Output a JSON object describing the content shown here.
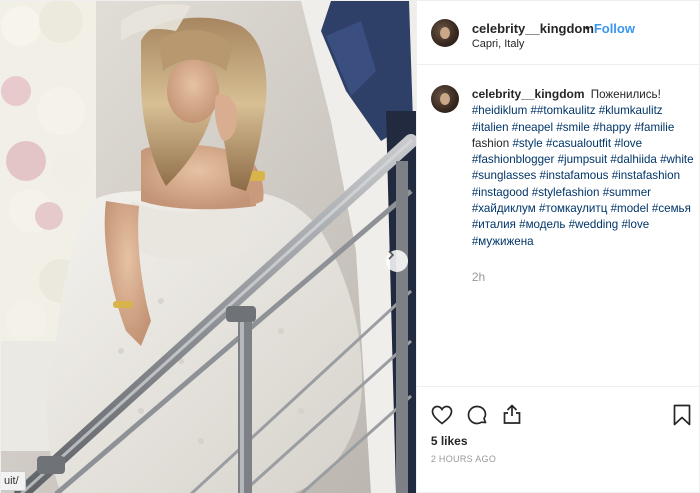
{
  "post": {
    "username": "celebrity__kingdom",
    "separator": "•",
    "follow_label": "Follow",
    "location": "Capri, Italy",
    "caption_text": "Поженились!",
    "hashtags": [
      "#heidiklum",
      "##tomkaulitz",
      "#klumkaulitz",
      "#italien",
      "#neapel",
      "#smile",
      "#happy",
      "#familie",
      "fashion",
      "#style",
      "#casualoutfit",
      "#love",
      "#fashionblogger",
      "#jumpsuit",
      "#dalhiida",
      "#white",
      "#sunglasses",
      "#instafamous",
      "#instafashion",
      "#instagood",
      "#stylefashion",
      "#summer",
      "#хайдиклум",
      "#томкаулитц",
      "#model",
      "#семья",
      "#италия",
      "#модель",
      "#wedding",
      "#love",
      "#мужижена"
    ],
    "time_ago": "2h",
    "likes": "5 likes",
    "posted": "2 HOURS AGO",
    "url_fragment": "uit/"
  },
  "icons": {
    "avatar": "avatar-icon",
    "like": "heart-icon",
    "comment": "comment-icon",
    "share": "share-icon",
    "save": "bookmark-icon",
    "next": "chevron-right-icon"
  },
  "colors": {
    "link": "#3897f0",
    "hashtag": "#003569",
    "muted": "#999999",
    "text": "#262626"
  }
}
